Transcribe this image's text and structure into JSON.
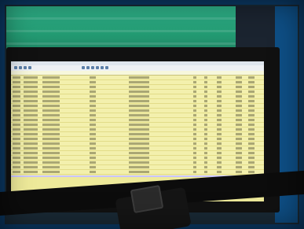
{
  "scene": {
    "colors": {
      "frame": "#0b3a66",
      "green_object": "#2fb38a",
      "monitor_bezel": "#111111",
      "spreadsheet": "#f3f0ad",
      "strap": "#0c0c0c"
    }
  }
}
